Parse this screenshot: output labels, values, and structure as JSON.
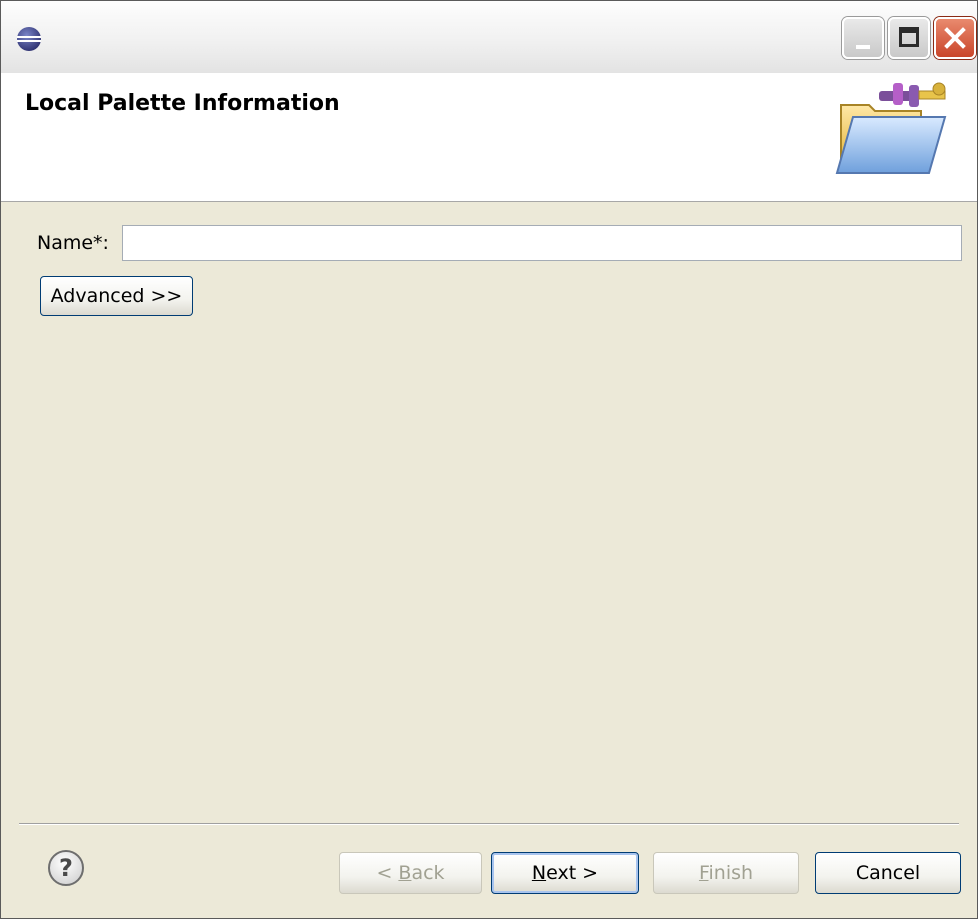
{
  "window": {
    "title": "",
    "accent_close": "#c9452a"
  },
  "banner": {
    "title": "Local Palette Information",
    "icon": "palette-folder-icon"
  },
  "form": {
    "name_label": "Name*:",
    "name_value": "",
    "name_placeholder": "",
    "advanced_label": "Advanced >>"
  },
  "footer": {
    "help_icon": "help-icon",
    "back_prefix": "< ",
    "back_mnemonic": "B",
    "back_rest": "ack",
    "next_mnemonic": "N",
    "next_rest": "ext >",
    "finish_mnemonic": "F",
    "finish_rest": "inish",
    "cancel_label": "Cancel"
  }
}
